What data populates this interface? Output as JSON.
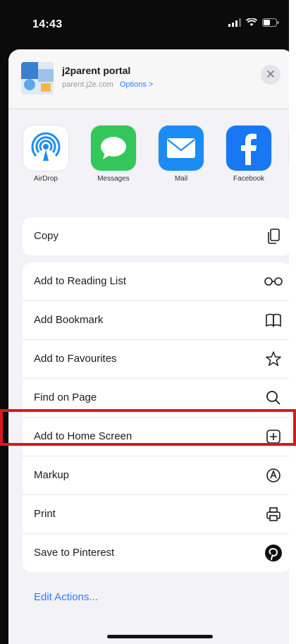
{
  "status_bar": {
    "time": "14:43"
  },
  "share_header": {
    "title": "j2parent portal",
    "subtitle": "parent.j2e.com",
    "options_label": "Options >",
    "close_glyph": "✕"
  },
  "apps": [
    {
      "label": "AirDrop",
      "icon": "airdrop-icon"
    },
    {
      "label": "Messages",
      "icon": "messages-icon"
    },
    {
      "label": "Mail",
      "icon": "mail-icon"
    },
    {
      "label": "Facebook",
      "icon": "facebook-icon"
    }
  ],
  "actions_group1": [
    {
      "label": "Copy",
      "icon": "copy-icon"
    }
  ],
  "actions_group2": [
    {
      "label": "Add to Reading List",
      "icon": "glasses-icon"
    },
    {
      "label": "Add Bookmark",
      "icon": "book-icon"
    },
    {
      "label": "Add to Favourites",
      "icon": "star-icon"
    },
    {
      "label": "Find on Page",
      "icon": "search-icon"
    },
    {
      "label": "Add to Home Screen",
      "icon": "add-square-icon"
    },
    {
      "label": "Markup",
      "icon": "markup-icon"
    },
    {
      "label": "Print",
      "icon": "printer-icon"
    },
    {
      "label": "Save to Pinterest",
      "icon": "pinterest-icon"
    }
  ],
  "edit_actions_label": "Edit Actions...",
  "colors": {
    "highlight": "#d81a1a",
    "link": "#2f7cf6"
  }
}
